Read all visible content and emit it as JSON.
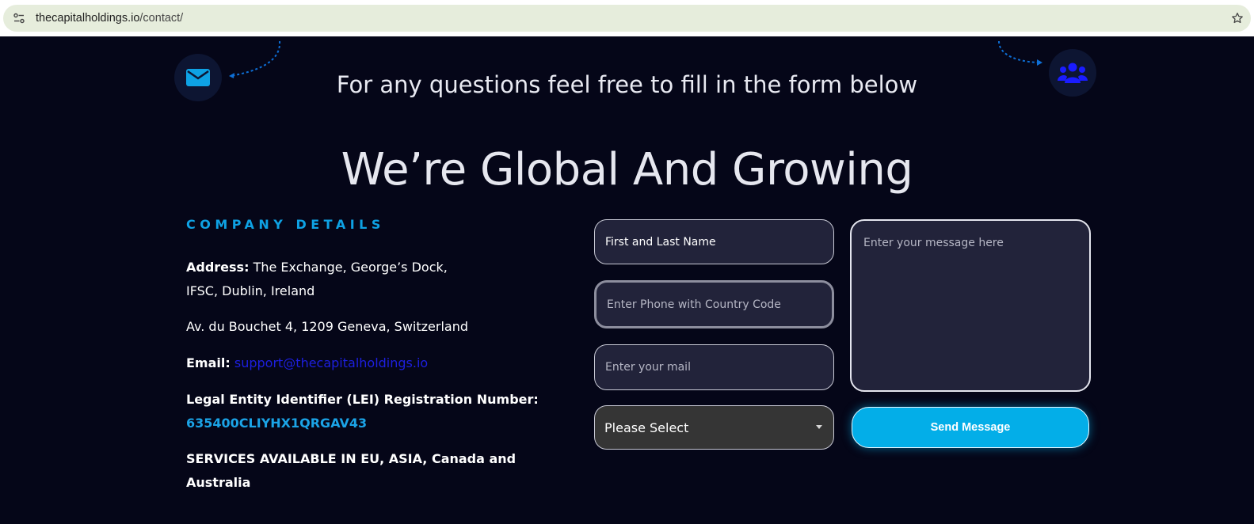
{
  "browser": {
    "url_domain": "thecapitalholdings.io",
    "url_path": "/contact/",
    "icons": [
      "site-info-icon",
      "bookmark-star-icon"
    ]
  },
  "hero": {
    "subtitle": "For any questions feel free to fill in the form below",
    "heading": "We’re Global And Growing",
    "icons": [
      "envelope-icon",
      "users-icon"
    ]
  },
  "details": {
    "title": "COMPANY DETAILS",
    "address_label": "Address:",
    "address_line1": " The Exchange, George’s Dock,",
    "address_line2": "IFSC, Dublin, Ireland",
    "address2": "Av. du Bouchet 4, 1209 Geneva, Switzerland",
    "email_label": "Email:",
    "email_value": "support@thecapitalholdings.io",
    "lei_label": "Legal Entity Identifier (LEI) Registration Number:",
    "lei_value": "635400CLIYHX1QRGAV43",
    "services_line1": "SERVICES AVAILABLE IN EU, ASIA, Canada and",
    "services_line2": "Australia"
  },
  "form": {
    "name_placeholder": "First and Last Name",
    "phone_placeholder": "Enter Phone with Country Code",
    "email_placeholder": "Enter your mail",
    "message_placeholder": "Enter your message here",
    "select_value": "Please Select",
    "send_label": "Send Message"
  },
  "colors": {
    "background": "#050618",
    "accent": "#03aee8",
    "link": "#1d1fe0",
    "lei": "#1ba3e6"
  }
}
